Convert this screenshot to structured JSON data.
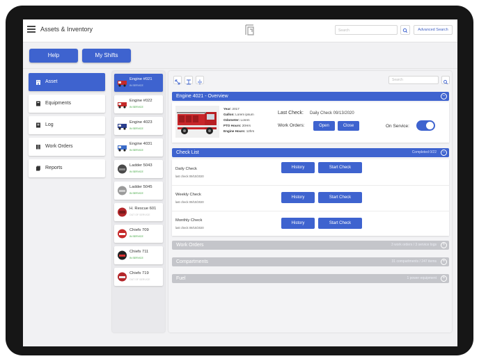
{
  "header": {
    "title": "Assets & Inventory",
    "search_placeholder": "Search",
    "advanced_search": "Advanced Search"
  },
  "top_buttons": {
    "help": "Help",
    "my_shifts": "My Shifts"
  },
  "sidebar": {
    "items": [
      {
        "label": "Asset",
        "icon": "building-icon",
        "active": true
      },
      {
        "label": "Equipments",
        "icon": "tool-icon",
        "active": false
      },
      {
        "label": "Log",
        "icon": "book-icon",
        "active": false
      },
      {
        "label": "Work Orders",
        "icon": "wrench-icon",
        "active": false
      },
      {
        "label": "Reports",
        "icon": "document-icon",
        "active": false
      }
    ]
  },
  "vehicles": [
    {
      "name": "Engine #021",
      "status": "IN SERVICE",
      "active": true
    },
    {
      "name": "Engine #022",
      "status": "IN SERVICE",
      "active": false
    },
    {
      "name": "Engine 4023",
      "status": "IN SERVICE",
      "active": false
    },
    {
      "name": "Engine 4031",
      "status": "IN SERVICE",
      "active": false
    },
    {
      "name": "Ladder 5043",
      "status": "IN SERVICE",
      "active": false
    },
    {
      "name": "Ladder 5045",
      "status": "IN SERVICE",
      "active": false
    },
    {
      "name": "H. Rescue 601",
      "status": "OUT OF SERVICE",
      "active": false
    },
    {
      "name": "Chiefs 709",
      "status": "IN SERVICE",
      "active": false
    },
    {
      "name": "Chiefs 711",
      "status": "IN SERVICE",
      "active": false
    },
    {
      "name": "Chiefs 719",
      "status": "OUT OF SERVICE",
      "active": false
    }
  ],
  "main": {
    "search_placeholder": "Search",
    "overview": {
      "title": "Engine 4021 - Overview",
      "specs": [
        {
          "label": "Year:",
          "value": "2017"
        },
        {
          "label": "Gallon:",
          "value": "Lorem ipsum"
        },
        {
          "label": "Odometer:",
          "value": "Lorem"
        },
        {
          "label": "PTO Hours:",
          "value": "20Hrs"
        },
        {
          "label": "Engine Hours:",
          "value": "12hrs"
        }
      ],
      "last_check_label": "Last Check:",
      "last_check_value": "Daily Check 09/13/2020",
      "work_orders_label": "Work Orders:",
      "open_button": "Open",
      "close_button": "Close",
      "on_service_label": "On Service:",
      "on_service": true
    },
    "checklist": {
      "title": "Check List",
      "summary": "Completed 0/22",
      "items": [
        {
          "name": "Daily Check",
          "date": "last check 09/10/2020"
        },
        {
          "name": "Weekly Check",
          "date": "last check 09/10/2020"
        },
        {
          "name": "Monthly Check",
          "date": "last check 09/10/2020"
        }
      ],
      "history_button": "History",
      "start_button": "Start Check"
    },
    "work_orders": {
      "title": "Work Orders",
      "summary": "3 work orders / 3 service logs"
    },
    "compartments": {
      "title": "Compartments",
      "summary": "31 compartments / 247 items"
    },
    "fuel": {
      "title": "Fuel",
      "summary": "1 power equipment"
    }
  },
  "colors": {
    "accent": "#3e63cf",
    "in_service": "#3aa33a",
    "collapsed_header": "#c4c5ca"
  }
}
